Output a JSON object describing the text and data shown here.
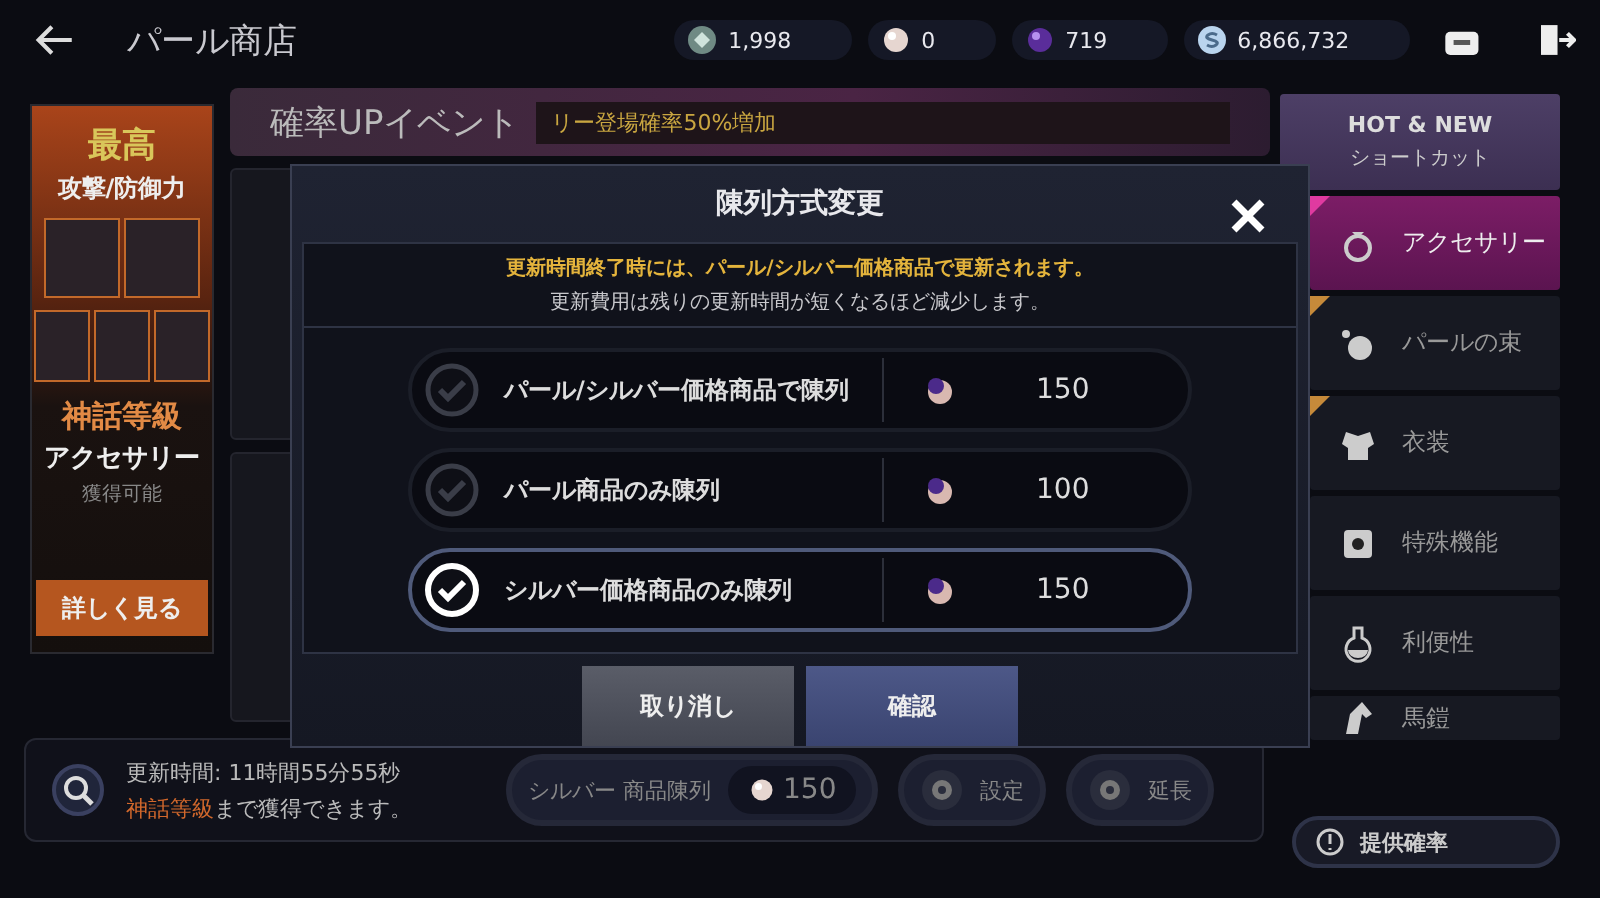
{
  "header": {
    "title": "パール商店",
    "currencies": [
      {
        "kind": "gem",
        "value": "1,998"
      },
      {
        "kind": "pearl",
        "value": "0"
      },
      {
        "kind": "orb",
        "value": "719"
      },
      {
        "kind": "silver",
        "value": "6,866,732"
      }
    ]
  },
  "promo": {
    "headline": "最高",
    "subline": "攻撃/防御力",
    "grade": "神話等級",
    "category": "アクセサリー",
    "note": "獲得可能",
    "button": "詳しく見る"
  },
  "banner": {
    "title": "確率UPイベント",
    "subtitle": "リー登場確率50%増加"
  },
  "sidebar": {
    "header": "HOT & NEW",
    "subheader": "ショートカット",
    "items": [
      {
        "label": "アクセサリー",
        "selected": true,
        "flagged": true
      },
      {
        "label": "パールの束",
        "selected": false,
        "flagged": true
      },
      {
        "label": "衣装",
        "selected": false,
        "flagged": true
      },
      {
        "label": "特殊機能",
        "selected": false,
        "flagged": false
      },
      {
        "label": "利便性",
        "selected": false,
        "flagged": false
      },
      {
        "label": "馬鎧",
        "selected": false,
        "flagged": false
      }
    ],
    "odds_button": "提供確率"
  },
  "bottom_bar": {
    "refresh_time": "更新時間: 11時間55分55秒",
    "notice": "**神話等級**まで獲得できます。",
    "actions": [
      {
        "kind": "price",
        "label": "シルバー 商品陳列",
        "price": "150"
      },
      {
        "kind": "gear",
        "label": "設定"
      },
      {
        "kind": "gear",
        "label": "延長"
      }
    ]
  },
  "dialog": {
    "title": "陳列方式変更",
    "notice_highlight": "更新時間終了時には、パール/シルバー価格商品で更新されます。",
    "notice": "更新費用は残りの更新時間が短くなるほど減少します。",
    "options": [
      {
        "label": "パール/シルバー価格商品で陳列",
        "price": "150",
        "selected": false
      },
      {
        "label": "パール商品のみ陳列",
        "price": "100",
        "selected": false
      },
      {
        "label": "シルバー価格商品のみ陳列",
        "price": "150",
        "selected": true
      }
    ],
    "cancel": "取り消し",
    "confirm": "確認"
  }
}
